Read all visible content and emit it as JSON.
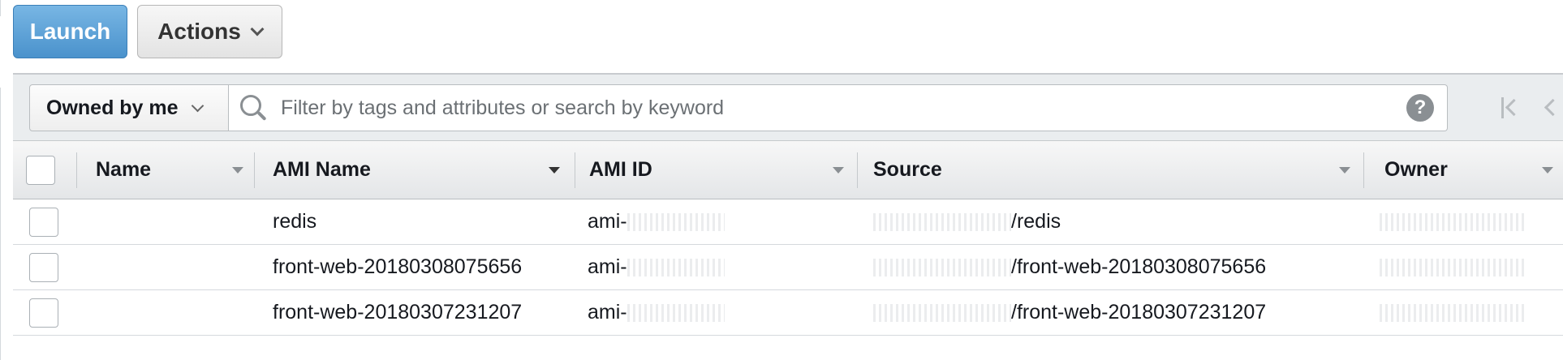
{
  "toolbar": {
    "launch_label": "Launch",
    "actions_label": "Actions"
  },
  "filter": {
    "owner_selected": "Owned by me",
    "search_placeholder": "Filter by tags and attributes or search by keyword",
    "help_symbol": "?"
  },
  "table": {
    "columns": [
      "Name",
      "AMI Name",
      "AMI ID",
      "Source",
      "Owner"
    ],
    "rows": [
      {
        "name": "",
        "ami_name": "redis",
        "ami_id": "ami-",
        "source": "/redis",
        "owner": ""
      },
      {
        "name": "",
        "ami_name": "front-web-20180308075656",
        "ami_id": "ami-",
        "source": "/front-web-20180308075656",
        "owner": ""
      },
      {
        "name": "",
        "ami_name": "front-web-20180307231207",
        "ami_id": "ami-",
        "source": "/front-web-20180307231207",
        "owner": ""
      }
    ]
  },
  "icons": {
    "search": "search-icon",
    "help": "help-icon",
    "first_page": "first-page-icon",
    "prev_page": "prev-page-icon"
  },
  "colors": {
    "launch_button": "#4a92cc",
    "header_bg": "#e4e6e8",
    "filter_bar_bg": "#eaedef"
  }
}
